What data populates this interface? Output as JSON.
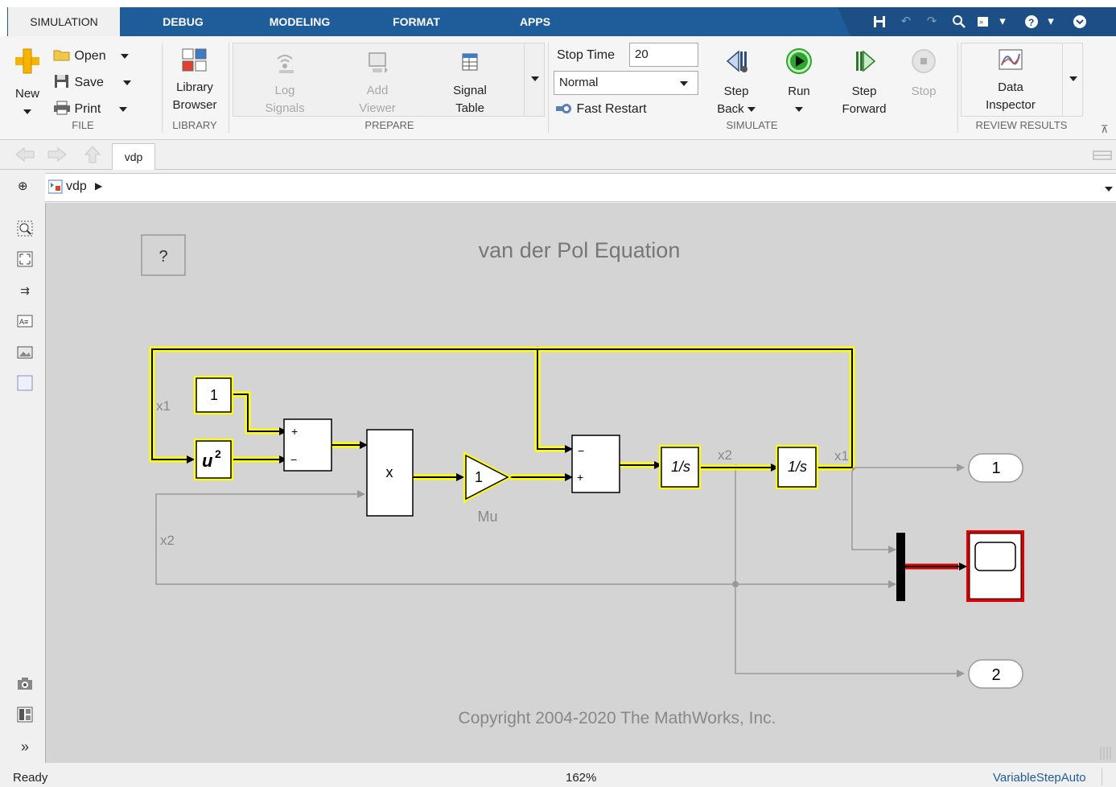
{
  "tabs": [
    {
      "label": "SIMULATION",
      "active": true
    },
    {
      "label": "DEBUG"
    },
    {
      "label": "MODELING"
    },
    {
      "label": "FORMAT"
    },
    {
      "label": "APPS"
    }
  ],
  "file": {
    "new_label": "New",
    "open_label": "Open",
    "save_label": "Save",
    "print_label": "Print",
    "group_label": "FILE"
  },
  "library": {
    "browser_label_1": "Library",
    "browser_label_2": "Browser",
    "group_label": "LIBRARY"
  },
  "prepare": {
    "log_1": "Log",
    "log_2": "Signals",
    "add_1": "Add",
    "add_2": "Viewer",
    "table_1": "Signal",
    "table_2": "Table",
    "group_label": "PREPARE"
  },
  "simulate": {
    "stop_time_label": "Stop Time",
    "stop_time_value": "20",
    "mode_value": "Normal",
    "fast_restart_label": "Fast Restart",
    "step_back_1": "Step",
    "step_back_2": "Back",
    "run_label": "Run",
    "step_fwd_1": "Step",
    "step_fwd_2": "Forward",
    "stop_label": "Stop",
    "group_label": "SIMULATE"
  },
  "review": {
    "inspector_1": "Data",
    "inspector_2": "Inspector",
    "group_label": "REVIEW RESULTS"
  },
  "nav": {
    "model_tab": "vdp"
  },
  "breadcrumb": {
    "model": "vdp"
  },
  "diagram": {
    "title": "van der Pol Equation",
    "help_block": "?",
    "const_value": "1",
    "square_label": "u",
    "square_exp": "2",
    "sum1_signs": [
      "+",
      "−"
    ],
    "product_label": "x",
    "gain_value": "1",
    "gain_name": "Mu",
    "sum2_signs": [
      "−",
      "+"
    ],
    "integrator_label": "1/s",
    "signal_x1": "x1",
    "signal_x2": "x2",
    "outport1": "1",
    "outport2": "2",
    "copyright": "Copyright 2004-2020 The MathWorks, Inc."
  },
  "status": {
    "left": "Ready",
    "zoom": "162%",
    "solver": "VariableStepAuto"
  },
  "colors": {
    "tab_blue": "#1e5d9a",
    "highlight": "#ffff00",
    "canvas": "#d4d4d4",
    "scope_border": "#e00000",
    "run_green": "#2aa82a"
  }
}
